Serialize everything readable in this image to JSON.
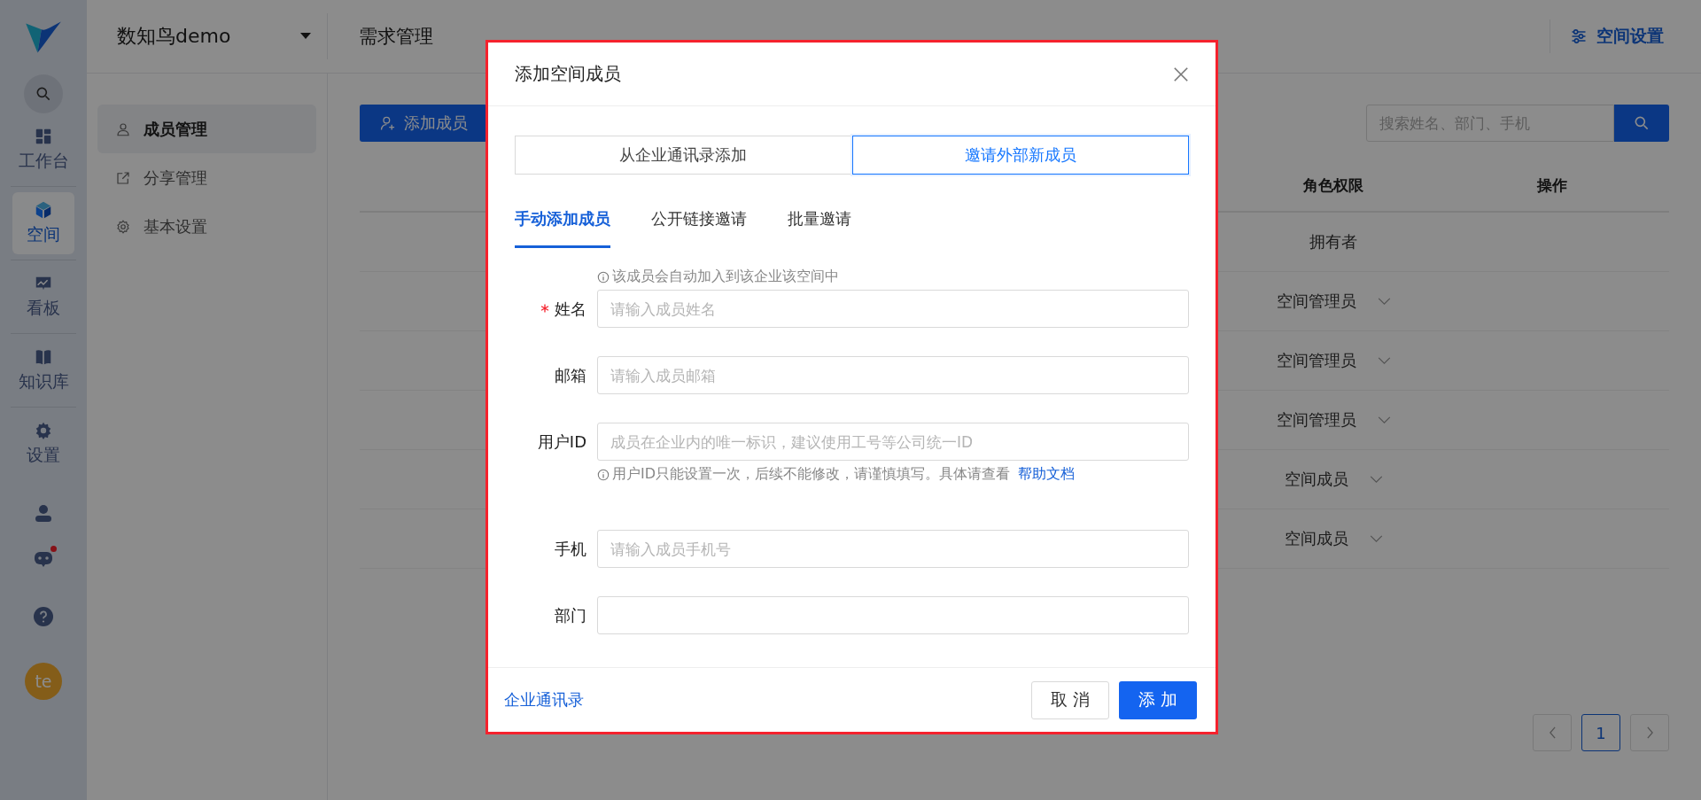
{
  "rail": {
    "items": [
      {
        "label": "工作台",
        "selected": false
      },
      {
        "label": "空间",
        "selected": true
      },
      {
        "label": "看板",
        "selected": false
      },
      {
        "label": "知识库",
        "selected": false
      },
      {
        "label": "设置",
        "selected": false
      }
    ],
    "bot_notification": true,
    "avatar": "te"
  },
  "workspace": {
    "name": "数知鸟demo"
  },
  "nav": [
    "需求管理"
  ],
  "settings_link": "空间设置",
  "side_menu": [
    {
      "label": "成员管理",
      "selected": true
    },
    {
      "label": "分享管理",
      "selected": false
    },
    {
      "label": "基本设置",
      "selected": false
    }
  ],
  "toolbar": {
    "add_button": "添加成员",
    "search_placeholder": "搜索姓名、部门、手机"
  },
  "table": {
    "columns": [
      "角色权限",
      "操作"
    ],
    "rows": [
      {
        "role": "拥有者",
        "dropdown": false
      },
      {
        "role": "空间管理员",
        "dropdown": true
      },
      {
        "role": "空间管理员",
        "dropdown": true
      },
      {
        "role": "空间管理员",
        "dropdown": true
      },
      {
        "role": "空间成员",
        "dropdown": true
      },
      {
        "role": "空间成员",
        "dropdown": true
      }
    ]
  },
  "pagination": {
    "pages": [
      {
        "label": "1",
        "selected": true
      }
    ]
  },
  "modal": {
    "title": "添加空间成员",
    "source_tabs": [
      {
        "label": "从企业通讯录添加",
        "selected": false
      },
      {
        "label": "邀请外部新成员",
        "selected": true
      }
    ],
    "tabs": [
      {
        "label": "手动添加成员",
        "selected": true
      },
      {
        "label": "公开链接邀请",
        "selected": false
      },
      {
        "label": "批量邀请",
        "selected": false
      }
    ],
    "fields": [
      {
        "label": "姓名",
        "required": true,
        "notice": "该成员会自动加入到该企业该空间中",
        "placeholder": "请输入成员姓名"
      },
      {
        "label": "邮箱",
        "required": false,
        "placeholder": "请输入成员邮箱"
      },
      {
        "label": "用户ID",
        "required": false,
        "placeholder": "成员在企业内的唯一标识，建议使用工号等公司统一ID",
        "note": "用户ID只能设置一次，后续不能修改，请谨慎填写。具体请查看",
        "note_link": "帮助文档"
      },
      {
        "label": "手机",
        "required": false,
        "placeholder": "请输入成员手机号"
      },
      {
        "label": "部门",
        "required": false
      }
    ],
    "footer_link": "企业通讯录",
    "buttons": [
      {
        "label": "取 消",
        "kind": "secondary"
      },
      {
        "label": "添 加",
        "kind": "primary"
      }
    ]
  }
}
